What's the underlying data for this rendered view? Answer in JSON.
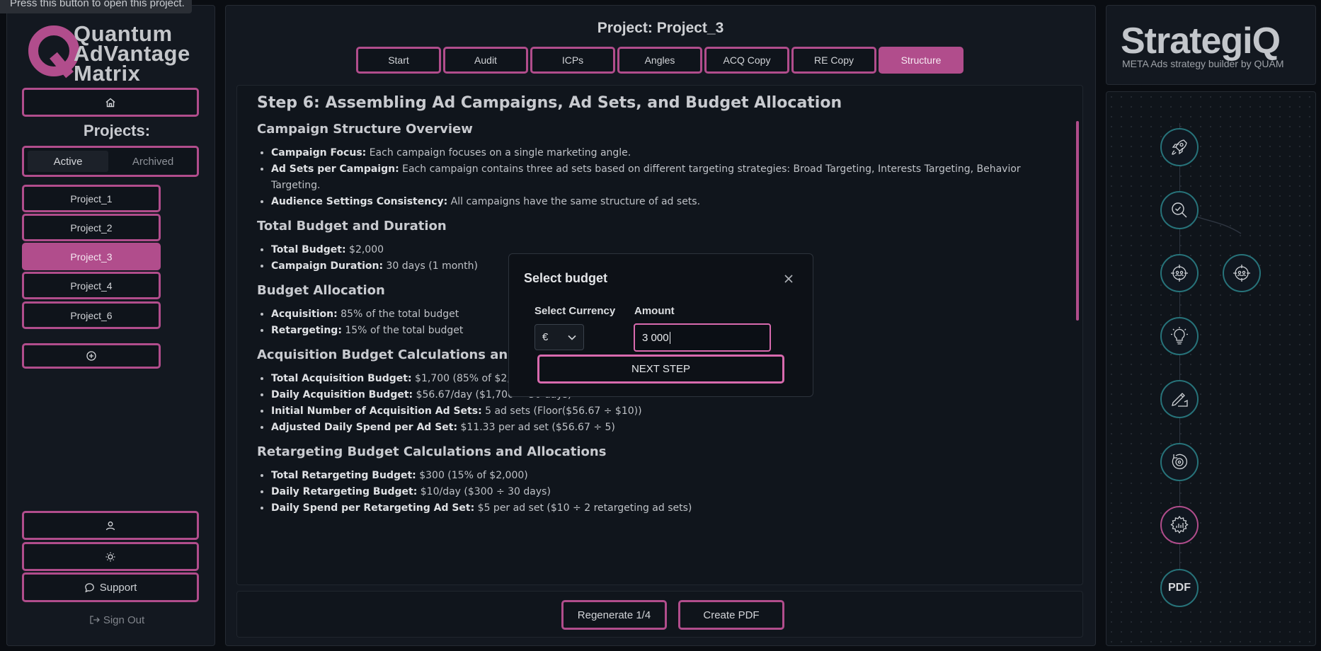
{
  "tooltip": "Press this button to open this project.",
  "logo": {
    "line1": "Quantum",
    "line2": "AdVantage",
    "line3": "Matrix",
    "letter": "Q"
  },
  "sidebar": {
    "projects_label": "Projects:",
    "segment": {
      "active": "Active",
      "archived": "Archived"
    },
    "projects": [
      "Project_1",
      "Project_2",
      "Project_3",
      "Project_4",
      "Project_6"
    ],
    "selected_project": "Project_3",
    "support": "Support",
    "sign_out": "Sign Out"
  },
  "main": {
    "title": "Project: Project_3",
    "tabs": [
      "Start",
      "Audit",
      "ICPs",
      "Angles",
      "ACQ Copy",
      "RE Copy",
      "Structure"
    ],
    "active_tab": "Structure",
    "doc": {
      "h1": "Step 6: Assembling Ad Campaigns, Ad Sets, and Budget Allocation",
      "sections": [
        {
          "h": "Campaign Structure Overview",
          "items": [
            {
              "b": "Campaign Focus:",
              "t": " Each campaign focuses on a single marketing angle."
            },
            {
              "b": "Ad Sets per Campaign:",
              "t": " Each campaign contains three ad sets based on different targeting strategies: Broad Targeting, Interests Targeting, Behavior Targeting."
            },
            {
              "b": "Audience Settings Consistency:",
              "t": " All campaigns have the same structure of ad sets."
            }
          ]
        },
        {
          "h": "Total Budget and Duration",
          "items": [
            {
              "b": "Total Budget:",
              "t": " $2,000"
            },
            {
              "b": "Campaign Duration:",
              "t": " 30 days (1 month)"
            }
          ]
        },
        {
          "h": "Budget Allocation",
          "items": [
            {
              "b": "Acquisition:",
              "t": " 85% of the total budget"
            },
            {
              "b": "Retargeting:",
              "t": " 15% of the total budget"
            }
          ]
        },
        {
          "h": "Acquisition Budget Calculations and Allocations",
          "items": [
            {
              "b": "Total Acquisition Budget:",
              "t": " $1,700 (85% of $2,000)"
            },
            {
              "b": "Daily Acquisition Budget:",
              "t": " $56.67/day ($1,700 ÷ 30 days)"
            },
            {
              "b": "Initial Number of Acquisition Ad Sets:",
              "t": " 5 ad sets (Floor($56.67 ÷ $10))"
            },
            {
              "b": "Adjusted Daily Spend per Ad Set:",
              "t": " $11.33 per ad set ($56.67 ÷ 5)"
            }
          ]
        },
        {
          "h": "Retargeting Budget Calculations and Allocations",
          "items": [
            {
              "b": "Total Retargeting Budget:",
              "t": " $300 (15% of $2,000)"
            },
            {
              "b": "Daily Retargeting Budget:",
              "t": " $10/day ($300 ÷ 30 days)"
            },
            {
              "b": "Daily Spend per Retargeting Ad Set:",
              "t": " $5 per ad set ($10 ÷ 2 retargeting ad sets)"
            }
          ]
        }
      ]
    },
    "regenerate": "Regenerate 1/4",
    "create_pdf": "Create PDF"
  },
  "modal": {
    "title": "Select budget",
    "currency_label": "Select Currency",
    "currency_value": "€",
    "amount_label": "Amount",
    "amount_value": "3 000",
    "next_step": "NEXT STEP"
  },
  "brand": {
    "name": "StrategiQ",
    "subtitle": "META Ads strategy builder by QUAM"
  },
  "steps": {
    "pdf_label": "PDF"
  },
  "colors": {
    "accent": "#b14d8c",
    "teal": "#27737a"
  }
}
